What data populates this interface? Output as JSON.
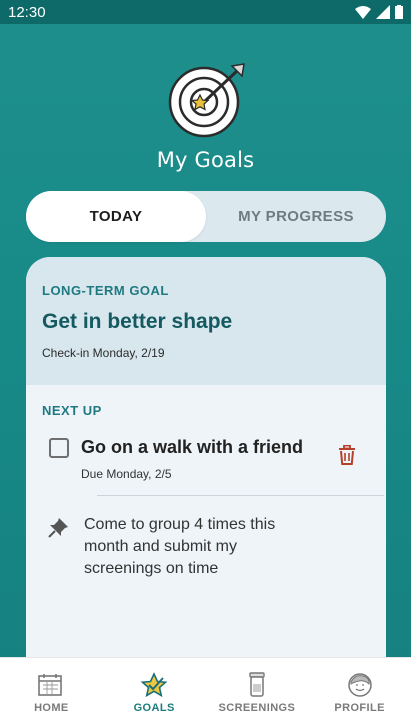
{
  "status_bar": {
    "time": "12:30"
  },
  "header": {
    "title": "My Goals"
  },
  "segmented": {
    "today": "TODAY",
    "progress": "MY PROGRESS"
  },
  "long_term": {
    "label": "LONG-TERM GOAL",
    "title": "Get in better shape",
    "checkin": "Check-in Monday, 2/19"
  },
  "next_up": {
    "label": "NEXT UP",
    "task_title": "Go on a walk with a friend",
    "task_due": "Due Monday, 2/5",
    "pinned_text": "Come to group 4 times this month and submit my screenings on time"
  },
  "tabs": [
    {
      "label": "HOME",
      "icon": "calendar-icon"
    },
    {
      "label": "GOALS",
      "icon": "star-icon"
    },
    {
      "label": "SCREENINGS",
      "icon": "cup-icon"
    },
    {
      "label": "PROFILE",
      "icon": "person-icon"
    }
  ],
  "colors": {
    "teal_bg": "#178a88",
    "accent": "#1a7d7e",
    "trash": "#b5412a"
  }
}
